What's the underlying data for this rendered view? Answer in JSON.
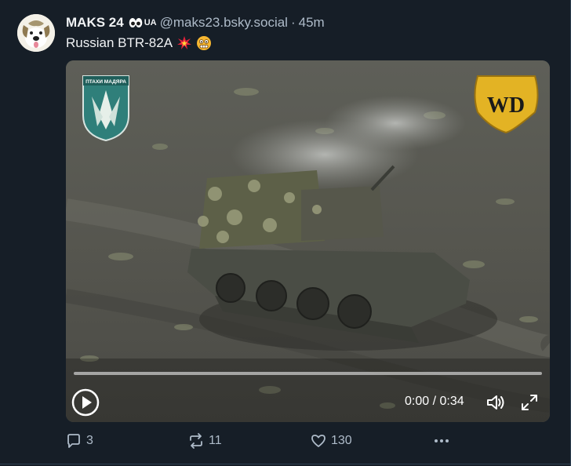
{
  "post": {
    "display_name": "MAKS 24",
    "flag_label": "UA",
    "handle": "@maks23.bsky.social",
    "separator": "·",
    "time": "45m",
    "text": "Russian BTR-82A"
  },
  "video": {
    "unit_patch_text": "ПТАХИ МАДЯРА",
    "watermark_text": "WD",
    "current_time": "0:00",
    "duration": "0:34",
    "time_readout": "0:00 / 0:34",
    "progress": 0.0
  },
  "actions": {
    "reply_count": "3",
    "repost_count": "11",
    "like_count": "130"
  },
  "icons": {
    "avatar": "dog-avatar-icon",
    "verified": "eyes-icon",
    "explosion": "explosion-emoji-icon",
    "face": "face-emoji-icon",
    "play": "play-icon",
    "volume": "volume-icon",
    "fullscreen": "fullscreen-icon",
    "reply": "reply-icon",
    "repost": "repost-icon",
    "like": "heart-icon",
    "more": "more-icon"
  },
  "colors": {
    "background": "#161e27",
    "text": "#f1f3f5",
    "muted": "#aebbc9",
    "border": "#2e4052"
  }
}
